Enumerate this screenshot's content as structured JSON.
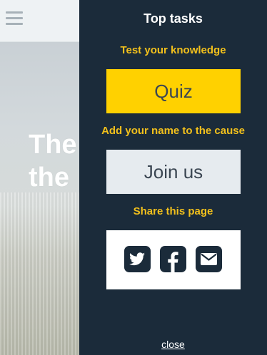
{
  "background": {
    "hero_line_1": "The",
    "hero_line_2": "the"
  },
  "menu": {
    "title": "Top tasks",
    "tasks": [
      {
        "prompt": "Test your knowledge",
        "button": "Quiz"
      },
      {
        "prompt": "Add your name to the cause",
        "button": "Join us"
      }
    ],
    "share": {
      "prompt": "Share this page",
      "icons": [
        "twitter-icon",
        "facebook-icon",
        "email-icon"
      ]
    },
    "close_label": "close"
  },
  "colors": {
    "panel": "#1b2b3a",
    "accent_text": "#f2c01c",
    "quiz_button": "#ffd100",
    "join_button": "#e6ebef"
  }
}
